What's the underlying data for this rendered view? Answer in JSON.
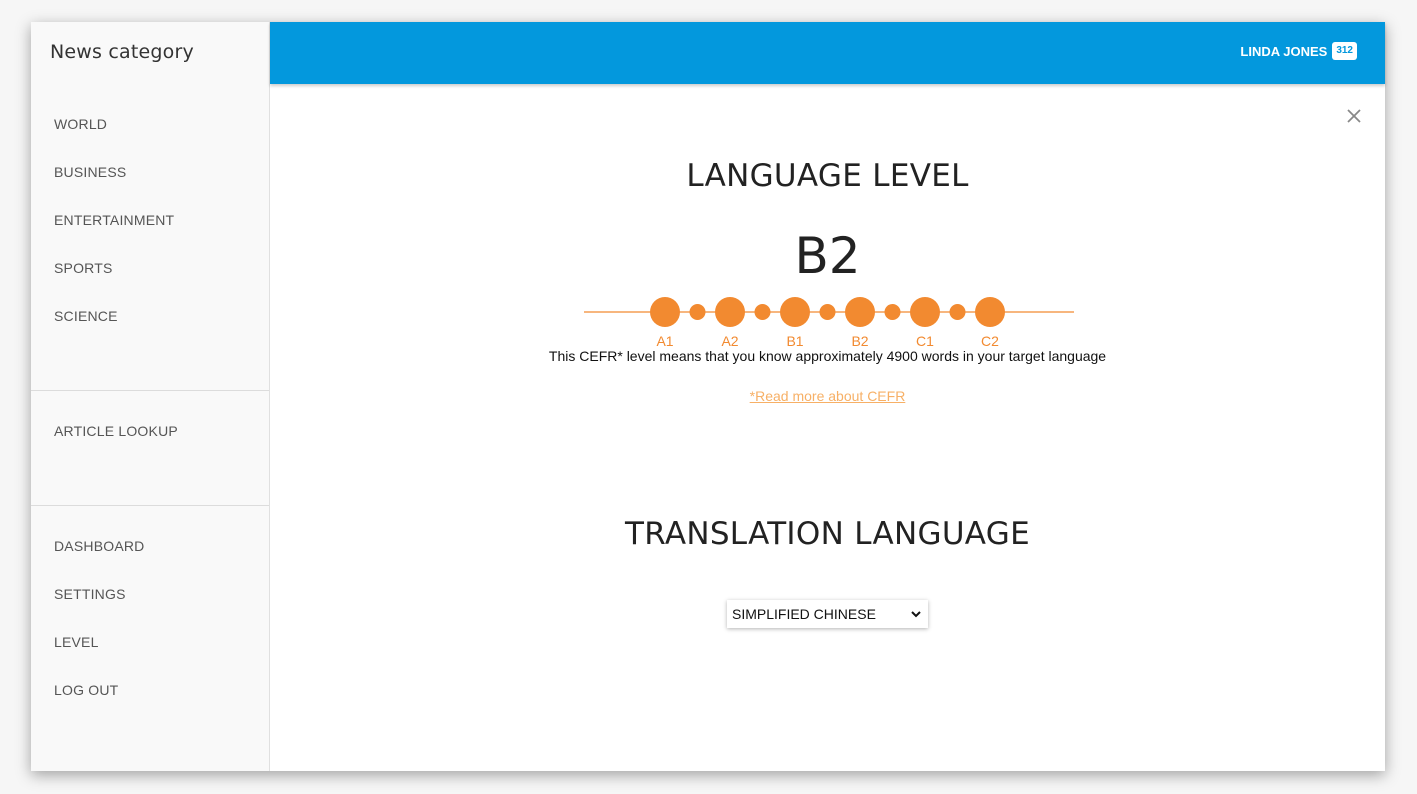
{
  "sidebar": {
    "title": "News category",
    "categories": [
      {
        "label": "WORLD"
      },
      {
        "label": "BUSINESS"
      },
      {
        "label": "ENTERTAINMENT"
      },
      {
        "label": "SPORTS"
      },
      {
        "label": "SCIENCE"
      }
    ],
    "lookup": {
      "label": "ARTICLE LOOKUP"
    },
    "account": [
      {
        "label": "DASHBOARD"
      },
      {
        "label": "SETTINGS"
      },
      {
        "label": "LEVEL"
      },
      {
        "label": "LOG OUT"
      }
    ]
  },
  "header": {
    "user_name": "LINDA JONES",
    "badge_count": "312",
    "color": "#0398dd"
  },
  "main": {
    "language_level_title": "LANGUAGE LEVEL",
    "current_level": "B2",
    "levels": [
      "A1",
      "A2",
      "B1",
      "B2",
      "C1",
      "C2"
    ],
    "accent_color": "#f28a30",
    "description": "This CEFR* level means that you know approximately 4900 words in your target language",
    "cefr_link": "*Read more about CEFR",
    "translation_title": "TRANSLATION LANGUAGE",
    "translation_selected": "SIMPLIFIED CHINESE"
  },
  "icons": {
    "close": "close-icon",
    "dropdown": "chevron-down-icon"
  }
}
